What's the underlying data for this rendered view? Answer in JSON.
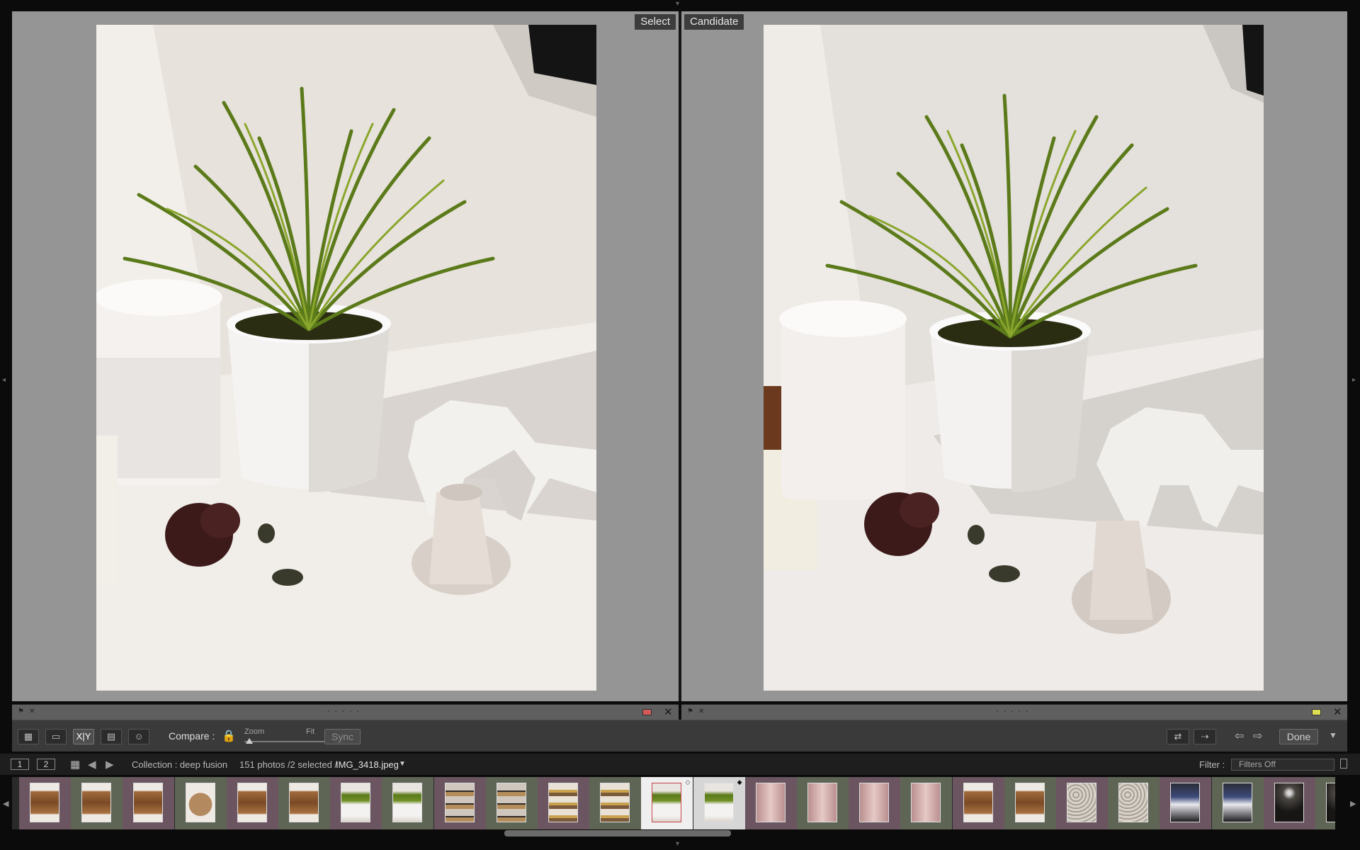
{
  "compare": {
    "select_label": "Select",
    "candidate_label": "Candidate"
  },
  "toolbar": {
    "view_grid_icon": "grid-view-icon",
    "view_loupe_icon": "loupe-view-icon",
    "view_compare_label": "X|Y",
    "view_survey_icon": "survey-view-icon",
    "view_people_icon": "people-view-icon",
    "compare_label": "Compare :",
    "zoom_label": "Zoom",
    "fit_label": "Fit",
    "sync_label": "Sync",
    "done_label": "Done"
  },
  "info_left": {
    "color_label": "#d45a5a"
  },
  "info_right": {
    "color_label": "#dede55"
  },
  "filmstrip_header": {
    "page1": "1",
    "page2": "2",
    "collection": "Collection : deep fusion",
    "count": "151 photos /2 selected /",
    "filename": "IMG_3418.jpeg",
    "filter_label": "Filter :",
    "filter_value": "Filters Off"
  },
  "thumbnails": [
    {
      "kind": "wood",
      "frame": "#6a5560"
    },
    {
      "kind": "wood",
      "frame": "#5f6555"
    },
    {
      "kind": "wood",
      "frame": "#6a5560"
    },
    {
      "kind": "log",
      "frame": "#5f6555"
    },
    {
      "kind": "wood",
      "frame": "#6a5560"
    },
    {
      "kind": "wood",
      "frame": "#5f6555"
    },
    {
      "kind": "plant",
      "frame": "#6a5560"
    },
    {
      "kind": "plant",
      "frame": "#5f6555"
    },
    {
      "kind": "shelf",
      "frame": "#6a5560"
    },
    {
      "kind": "shelf",
      "frame": "#5f6555"
    },
    {
      "kind": "shelf2",
      "frame": "#6a5560"
    },
    {
      "kind": "shelf2",
      "frame": "#5f6555"
    },
    {
      "kind": "plant",
      "frame": "#e8e8e8",
      "selected": "select"
    },
    {
      "kind": "plant",
      "frame": "#cfcfcf",
      "selected": "candidate"
    },
    {
      "kind": "pink",
      "frame": "#6a5560"
    },
    {
      "kind": "pink",
      "frame": "#5f6555"
    },
    {
      "kind": "pink",
      "frame": "#6a5560"
    },
    {
      "kind": "pink",
      "frame": "#5f6555"
    },
    {
      "kind": "wood",
      "frame": "#6a5560"
    },
    {
      "kind": "wood",
      "frame": "#5f6555"
    },
    {
      "kind": "lace",
      "frame": "#6a5560"
    },
    {
      "kind": "lace",
      "frame": "#5f6555"
    },
    {
      "kind": "desk",
      "frame": "#6a5560"
    },
    {
      "kind": "desk",
      "frame": "#5f6555"
    },
    {
      "kind": "dark",
      "frame": "#6a5560"
    },
    {
      "kind": "dark",
      "frame": "#5f6555"
    }
  ]
}
